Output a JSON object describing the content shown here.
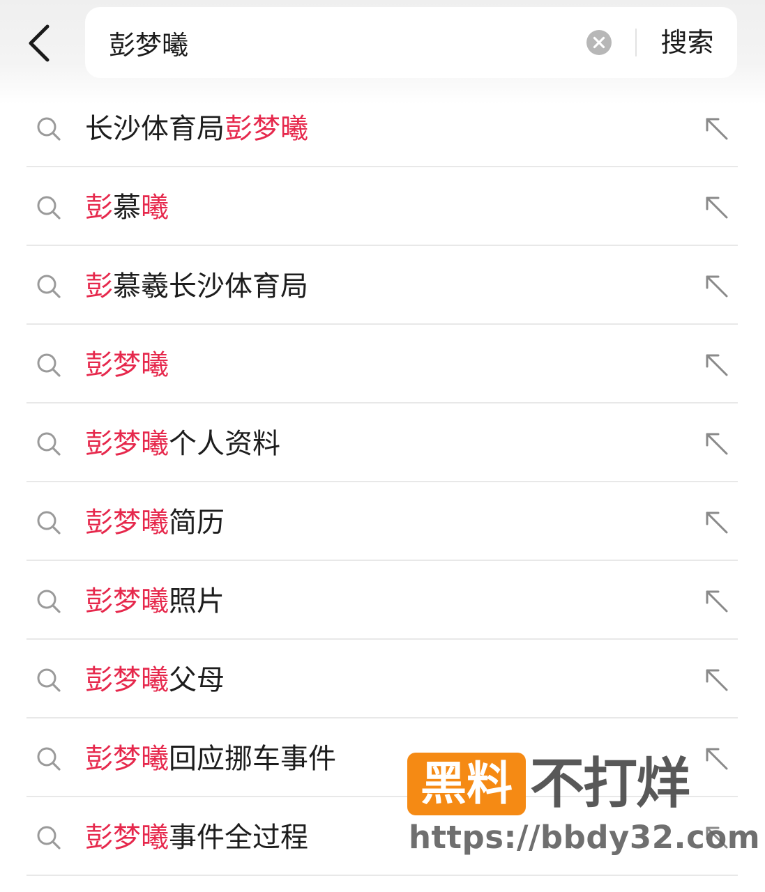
{
  "search": {
    "query": "彭梦曦",
    "submit_label": "搜索"
  },
  "icons": {
    "back": "chevron-left-icon",
    "clear": "clear-circle-x-icon",
    "suggestion": "search-icon",
    "fill": "arrow-up-left-icon"
  },
  "colors": {
    "highlight": "#e6284c",
    "watermark_badge": "#f58a14"
  },
  "suggestions": [
    {
      "parts": [
        {
          "text": "长沙体育局",
          "hl": false
        },
        {
          "text": "彭梦曦",
          "hl": true
        }
      ]
    },
    {
      "parts": [
        {
          "text": "彭",
          "hl": true
        },
        {
          "text": "慕",
          "hl": false
        },
        {
          "text": "曦",
          "hl": true
        }
      ]
    },
    {
      "parts": [
        {
          "text": "彭",
          "hl": true
        },
        {
          "text": "慕羲长沙体育局",
          "hl": false
        }
      ]
    },
    {
      "parts": [
        {
          "text": "彭梦曦",
          "hl": true
        }
      ]
    },
    {
      "parts": [
        {
          "text": "彭梦曦",
          "hl": true
        },
        {
          "text": "个人资料",
          "hl": false
        }
      ]
    },
    {
      "parts": [
        {
          "text": "彭梦曦",
          "hl": true
        },
        {
          "text": "简历",
          "hl": false
        }
      ]
    },
    {
      "parts": [
        {
          "text": "彭梦曦",
          "hl": true
        },
        {
          "text": "照片",
          "hl": false
        }
      ]
    },
    {
      "parts": [
        {
          "text": "彭梦曦",
          "hl": true
        },
        {
          "text": "父母",
          "hl": false
        }
      ]
    },
    {
      "parts": [
        {
          "text": "彭梦曦",
          "hl": true
        },
        {
          "text": "回应挪车事件",
          "hl": false
        }
      ]
    },
    {
      "parts": [
        {
          "text": "彭梦曦",
          "hl": true
        },
        {
          "text": "事件全过程",
          "hl": false
        }
      ]
    }
  ],
  "watermark": {
    "badge_text": "黑料",
    "title_text": "不打烊",
    "url_text": "https://bbdy32.com"
  }
}
